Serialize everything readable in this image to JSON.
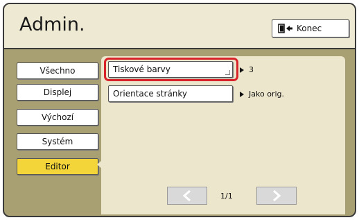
{
  "header": {
    "title": "Admin.",
    "exit_label": "Konec"
  },
  "sidebar": {
    "items": [
      {
        "label": "Všechno"
      },
      {
        "label": "Displej"
      },
      {
        "label": "Výchozí"
      },
      {
        "label": "Systém"
      },
      {
        "label": "Editor",
        "active": true
      }
    ]
  },
  "settings": [
    {
      "label": "Tiskové barvy",
      "value": "3"
    },
    {
      "label": "Orientace stránky",
      "value": "Jako orig."
    }
  ],
  "pagination": {
    "indicator": "1/1"
  },
  "colors": {
    "accent_active": "#f3d53a",
    "highlight": "#d8232a",
    "header_bg": "#eee9d2",
    "frame_bg": "#a89f73",
    "panel_bg": "#ece6cc"
  }
}
